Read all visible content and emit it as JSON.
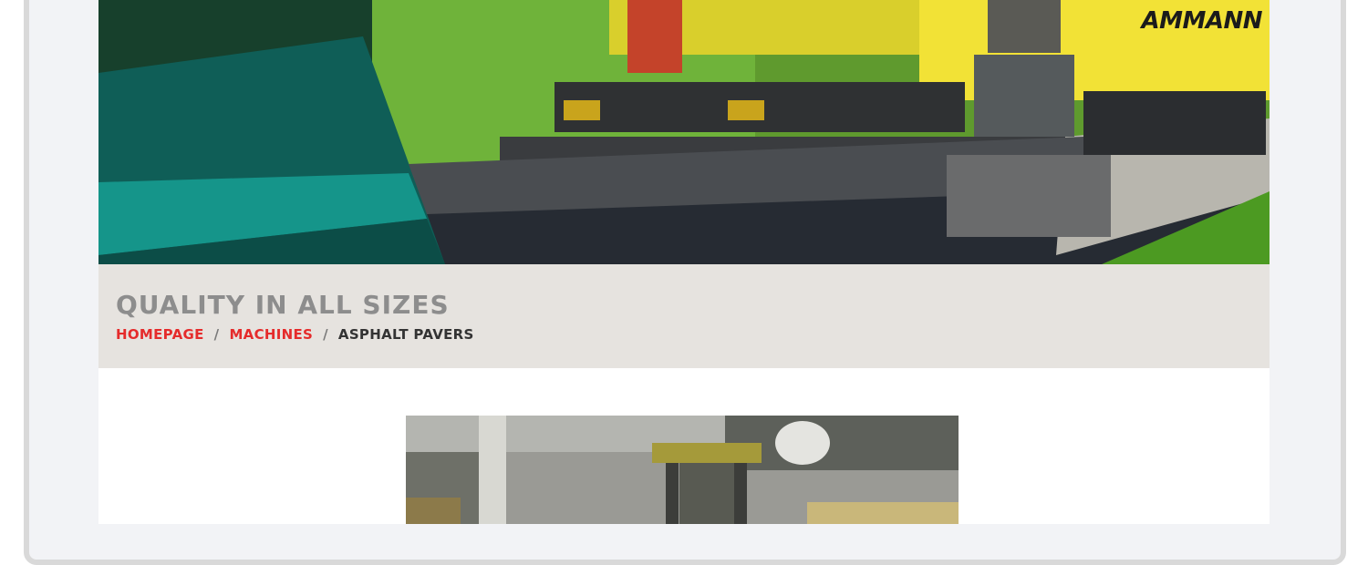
{
  "hero": {
    "brand": "AMMANN",
    "image": "asphalt-paver-machine-photo"
  },
  "title_band": {
    "title": "QUALITY IN ALL SIZES",
    "breadcrumb": [
      {
        "label": "HOMEPAGE",
        "link": true
      },
      {
        "label": "MACHINES",
        "link": true
      },
      {
        "label": "ASPHALT PAVERS",
        "link": false
      }
    ],
    "separator": "/"
  },
  "content": {
    "image": "paver-in-workshop-photo"
  },
  "colors": {
    "accent_red": "#e52b2b",
    "title_gray": "#8d8d8d",
    "band_bg": "#e6e3df",
    "teal": "#0f6e66",
    "machine_yellow": "#f2e236"
  }
}
